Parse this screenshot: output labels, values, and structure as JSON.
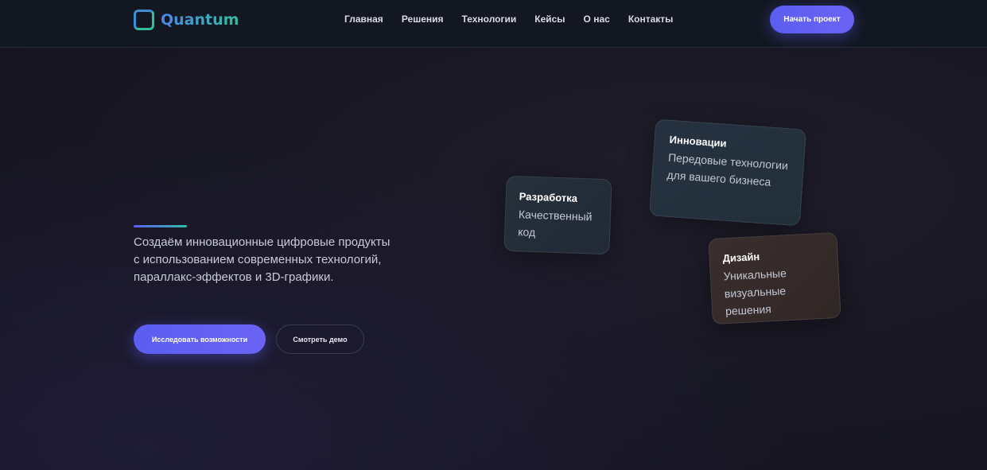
{
  "header": {
    "logo_text": "Quantum",
    "nav": [
      "Главная",
      "Решения",
      "Технологии",
      "Кейсы",
      "О нас",
      "Контакты"
    ],
    "cta_label": "Начать проект"
  },
  "hero": {
    "description": "Создаём инновационные цифровые продукты с использованием современных технологий, параллакс-эффектов и 3D-графики.",
    "primary_button": "Исследовать возможности",
    "secondary_button": "Смотреть демо"
  },
  "cards": {
    "development": {
      "title": "Разработка",
      "description": "Качественный код"
    },
    "innovation": {
      "title": "Инновации",
      "description": "Передовые технологии для вашего бизнеса"
    },
    "design": {
      "title": "Дизайн",
      "description": "Уникальные визуальные решения"
    }
  },
  "colors": {
    "accent": "#5b5ef0",
    "teal": "#2fbf9f",
    "background": "#181723"
  }
}
